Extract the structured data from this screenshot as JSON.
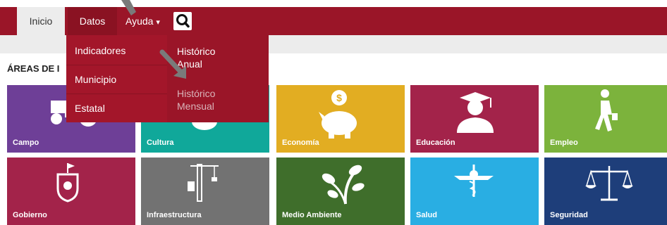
{
  "nav": {
    "inicio": "Inicio",
    "datos": "Datos",
    "ayuda": "Ayuda",
    "ayuda_caret": "▾"
  },
  "section_title": "ÁREAS DE I",
  "dropdown": {
    "items": [
      "Indicadores",
      "Municipio",
      "Estatal"
    ]
  },
  "submenu": {
    "anual": "Histórico\nAnual",
    "mensual": "Histórico\nMensual"
  },
  "tiles": [
    {
      "label": "Campo",
      "color": "#6e3f97",
      "icon": "tractor-icon"
    },
    {
      "label": "Cultura",
      "color": "#10a89a",
      "icon": "theater-icon"
    },
    {
      "label": "Economía",
      "color": "#e2ad22",
      "icon": "piggy-bank-icon"
    },
    {
      "label": "Educación",
      "color": "#a3234a",
      "icon": "graduate-icon"
    },
    {
      "label": "Empleo",
      "color": "#7cb33c",
      "icon": "walking-person-icon"
    },
    {
      "label": "Gobierno",
      "color": "#a3234a",
      "icon": "coat-of-arms-icon"
    },
    {
      "label": "Infraestructura",
      "color": "#727272",
      "icon": "crane-icon"
    },
    {
      "label": "Medio Ambiente",
      "color": "#3f6e2b",
      "icon": "plant-icon"
    },
    {
      "label": "Salud",
      "color": "#29aee3",
      "icon": "caduceus-icon"
    },
    {
      "label": "Seguridad",
      "color": "#1e3e7a",
      "icon": "scales-icon"
    }
  ],
  "colors": {
    "navbar": "#9a1528",
    "dropdown": "#a3162a",
    "pointer_arrow": "#7a7a7a"
  }
}
